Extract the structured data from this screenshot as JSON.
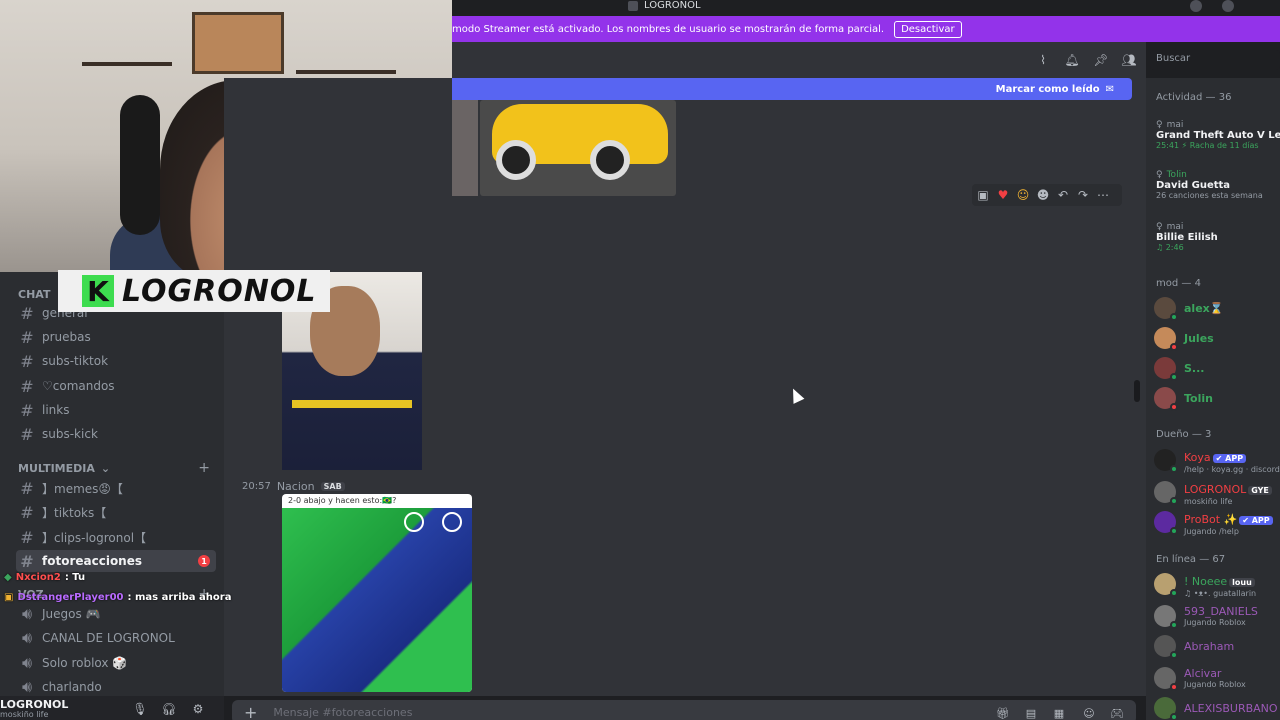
{
  "window": {
    "title": "LOGRONOL"
  },
  "notice": {
    "text": "modo Streamer está activado. Los nombres de usuario se mostrarán de forma parcial.",
    "button": "Desactivar"
  },
  "overlay": {
    "logo_letter": "K",
    "logo_text": "LOGRONOL"
  },
  "sidebar": {
    "chat_category": "CHAT",
    "channels_top": [
      {
        "name": "general",
        "icon": "hash"
      },
      {
        "name": "pruebas",
        "icon": "hash"
      },
      {
        "name": "subs-tiktok",
        "icon": "hash"
      },
      {
        "name": "♡comandos",
        "icon": "hash"
      },
      {
        "name": "links",
        "icon": "hash"
      },
      {
        "name": "subs-kick",
        "icon": "hash"
      }
    ],
    "multimedia_category": "MULTIMEDIA",
    "channels_media": [
      {
        "name": "】memes😡【",
        "icon": "hash"
      },
      {
        "name": "】tiktoks【",
        "icon": "hash"
      },
      {
        "name": "】clips-logronol【",
        "icon": "hash"
      },
      {
        "name": "fotoreacciones",
        "icon": "hash",
        "active": true,
        "badge": "1"
      }
    ],
    "voice_category": "VOZ",
    "voice_channels": [
      {
        "name": "Juegos 🎮",
        "icon": "speaker"
      },
      {
        "name": "CANAL DE LOGRONOL",
        "icon": "speaker"
      },
      {
        "name": "Solo roblox 🎲",
        "icon": "speaker"
      },
      {
        "name": "charlando",
        "icon": "speaker"
      }
    ],
    "user": {
      "name": "LOGRONOL",
      "sub": "moskiño life"
    }
  },
  "twitch_chat": [
    {
      "user": "Nxcion2",
      "text": ": Tu",
      "color": "#ff4f4f"
    },
    {
      "user": "DstrangerPlayer00",
      "text": ": mas arriba ahora",
      "color": "#b96bff"
    }
  ],
  "header": {
    "search_placeholder": "Buscar"
  },
  "chat": {
    "unread_banner": "Marcar como leído",
    "message": {
      "time": "20:57",
      "author": "Nacion",
      "tag": "SAB"
    },
    "soccer_caption": "2-0 abajo y hacen esto:🇧🇷?",
    "composer_placeholder": "Mensaje #fotoreacciones"
  },
  "members": {
    "activity_header": "Actividad — 36",
    "activities": [
      {
        "user": "mai",
        "game": "Grand Theft Auto V Legacy",
        "detail": "25:41  ⚡ Racha de 11 días",
        "user_color": "#949ba4"
      },
      {
        "user": "Tolin",
        "game": "David Guetta",
        "detail": "26 canciones esta semana",
        "user_color": "#3ba55d"
      },
      {
        "user": "mai",
        "game": "Billie Eilish",
        "detail": "♫ 2:46",
        "user_color": "#949ba4"
      }
    ],
    "mod_header": "mod — 4",
    "mods": [
      {
        "name": "alex⌛",
        "color": "#3ba55d",
        "status": "#23a55a",
        "avatar": "#5a4a3e"
      },
      {
        "name": "Jules",
        "color": "#3ba55d",
        "status": "#f23f43",
        "avatar": "#c58a5a"
      },
      {
        "name": "S...",
        "color": "#3ba55d",
        "status": "#23a55a",
        "avatar": "#7a3a3a"
      },
      {
        "name": "Tolin",
        "color": "#3ba55d",
        "status": "#f23f43",
        "avatar": "#8a4a4a"
      }
    ],
    "owner_header": "Dueño — 3",
    "owners": [
      {
        "name": "Koya",
        "tag": "✔ APP",
        "sub": "/help · koya.gg · discord.g",
        "color": "#f23f43",
        "status": "#23a55a",
        "avatar": "#222"
      },
      {
        "name": "LOGRONOL",
        "tag": "GYE",
        "sub": "moskiño life",
        "color": "#f23f43",
        "status": "#23a55a",
        "avatar": "#666"
      },
      {
        "name": "ProBot ✨",
        "tag": "✔ APP",
        "sub": "Jugando /help",
        "color": "#f23f43",
        "status": "#23a55a",
        "avatar": "#5c2aa0"
      }
    ],
    "online_header": "En línea — 67",
    "online": [
      {
        "name": "! Noeee",
        "tag": "louu",
        "sub": "♫ •ᴥ•. guatallarin",
        "color": "#3ba55d",
        "status": "#23a55a",
        "avatar": "#b8a070"
      },
      {
        "name": "593_DANIELS",
        "tag": "",
        "sub": "Jugando Roblox",
        "color": "#9b59b6",
        "status": "#23a55a",
        "avatar": "#777"
      },
      {
        "name": "Abraham",
        "tag": "",
        "sub": "",
        "color": "#9b59b6",
        "status": "#23a55a",
        "avatar": "#555"
      },
      {
        "name": "Alcivar",
        "tag": "",
        "sub": "Jugando Roblox",
        "color": "#9b59b6",
        "status": "#f23f43",
        "avatar": "#666"
      },
      {
        "name": "ALEXISBURBANO",
        "tag": "",
        "sub": "",
        "color": "#9b59b6",
        "status": "#23a55a",
        "avatar": "#4a6a3a"
      }
    ]
  }
}
